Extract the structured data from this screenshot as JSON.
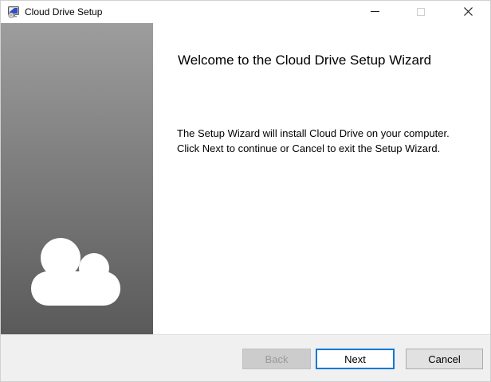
{
  "window": {
    "title": "Cloud Drive Setup",
    "icons": {
      "app": "msi-installer-icon",
      "minimize": "minimize-icon",
      "maximize": "maximize-icon",
      "close": "close-icon"
    },
    "maximize_disabled": true
  },
  "sidebar": {
    "icon": "cloud-icon",
    "gradient_top": "#9d9d9d",
    "gradient_bottom": "#5a5a5a"
  },
  "main": {
    "heading": "Welcome to the Cloud Drive Setup Wizard",
    "body_line1": "The Setup Wizard will install Cloud Drive on your computer.",
    "body_line2": "Click Next to continue or Cancel to exit the Setup Wizard."
  },
  "footer": {
    "back_label": "Back",
    "next_label": "Next",
    "cancel_label": "Cancel",
    "back_disabled": true,
    "next_focused": true
  },
  "colors": {
    "accent_focus_border": "#0078d7",
    "footer_bg": "#f0f0f0",
    "separator": "#dfdfdf",
    "disabled_button_bg": "#cccccc",
    "disabled_button_text": "#9a9a9a",
    "button_bg": "#e1e1e1",
    "button_border": "#adadad"
  }
}
